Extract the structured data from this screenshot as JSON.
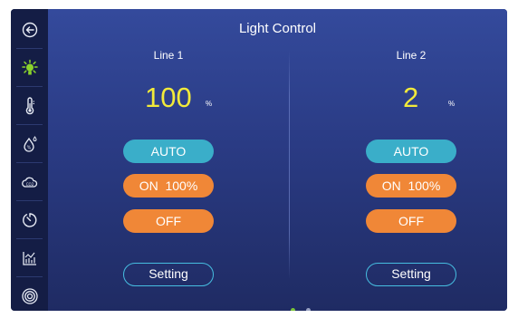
{
  "title": "Light Control",
  "sidebar": {
    "items": [
      {
        "icon": "back-arrow-icon",
        "active": false
      },
      {
        "icon": "light-bulb-icon",
        "active": true
      },
      {
        "icon": "thermometer-icon",
        "active": false
      },
      {
        "icon": "humidity-drop-icon",
        "active": false
      },
      {
        "icon": "co2-cloud-icon",
        "active": false
      },
      {
        "icon": "timer-icon",
        "active": false
      },
      {
        "icon": "bar-chart-icon",
        "active": false
      },
      {
        "icon": "ring-target-icon",
        "active": false
      }
    ],
    "active_color": "#8bd42b",
    "icon_color": "#e8ecf5"
  },
  "lines": [
    {
      "label": "Line 1",
      "level": "100",
      "unit": "%",
      "auto_label": "AUTO",
      "on_label": "ON  100%",
      "off_label": "OFF",
      "setting_label": "Setting"
    },
    {
      "label": "Line 2",
      "level": "2",
      "unit": "%",
      "auto_label": "AUTO",
      "on_label": "ON  100%",
      "off_label": "OFF",
      "setting_label": "Setting"
    }
  ],
  "pagination": {
    "count": 2,
    "active": 0,
    "active_color": "#7cc63a",
    "inactive_color": "#9aa3c4"
  },
  "colors": {
    "auto": "#3aaec9",
    "on_off": "#f08737",
    "level_text": "#f2ea3a",
    "setting_border": "#46bde0"
  }
}
